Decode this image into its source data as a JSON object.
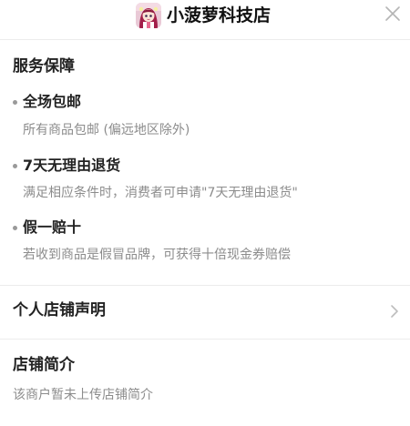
{
  "header": {
    "store_name": "小菠萝科技店",
    "logo_icon": "store-avatar-anime-girl",
    "close_icon": "close-icon"
  },
  "service": {
    "title": "服务保障",
    "items": [
      {
        "title": "全场包邮",
        "desc": "所有商品包邮 (偏远地区除外)"
      },
      {
        "title": "7天无理由退货",
        "desc": "满足相应条件时，消费者可申请\"7天无理由退货\""
      },
      {
        "title": "假一赔十",
        "desc": "若收到商品是假冒品牌，可获得十倍现金券赔偿"
      }
    ]
  },
  "statement": {
    "label": "个人店铺声明",
    "icon": "chevron-right-icon"
  },
  "intro": {
    "title": "店铺简介",
    "desc": "该商户暂未上传店铺简介"
  },
  "colors": {
    "title_text": "#222222",
    "secondary_text": "#8c8c8c",
    "divider": "#ececec",
    "bullet": "#9a9a9a"
  }
}
